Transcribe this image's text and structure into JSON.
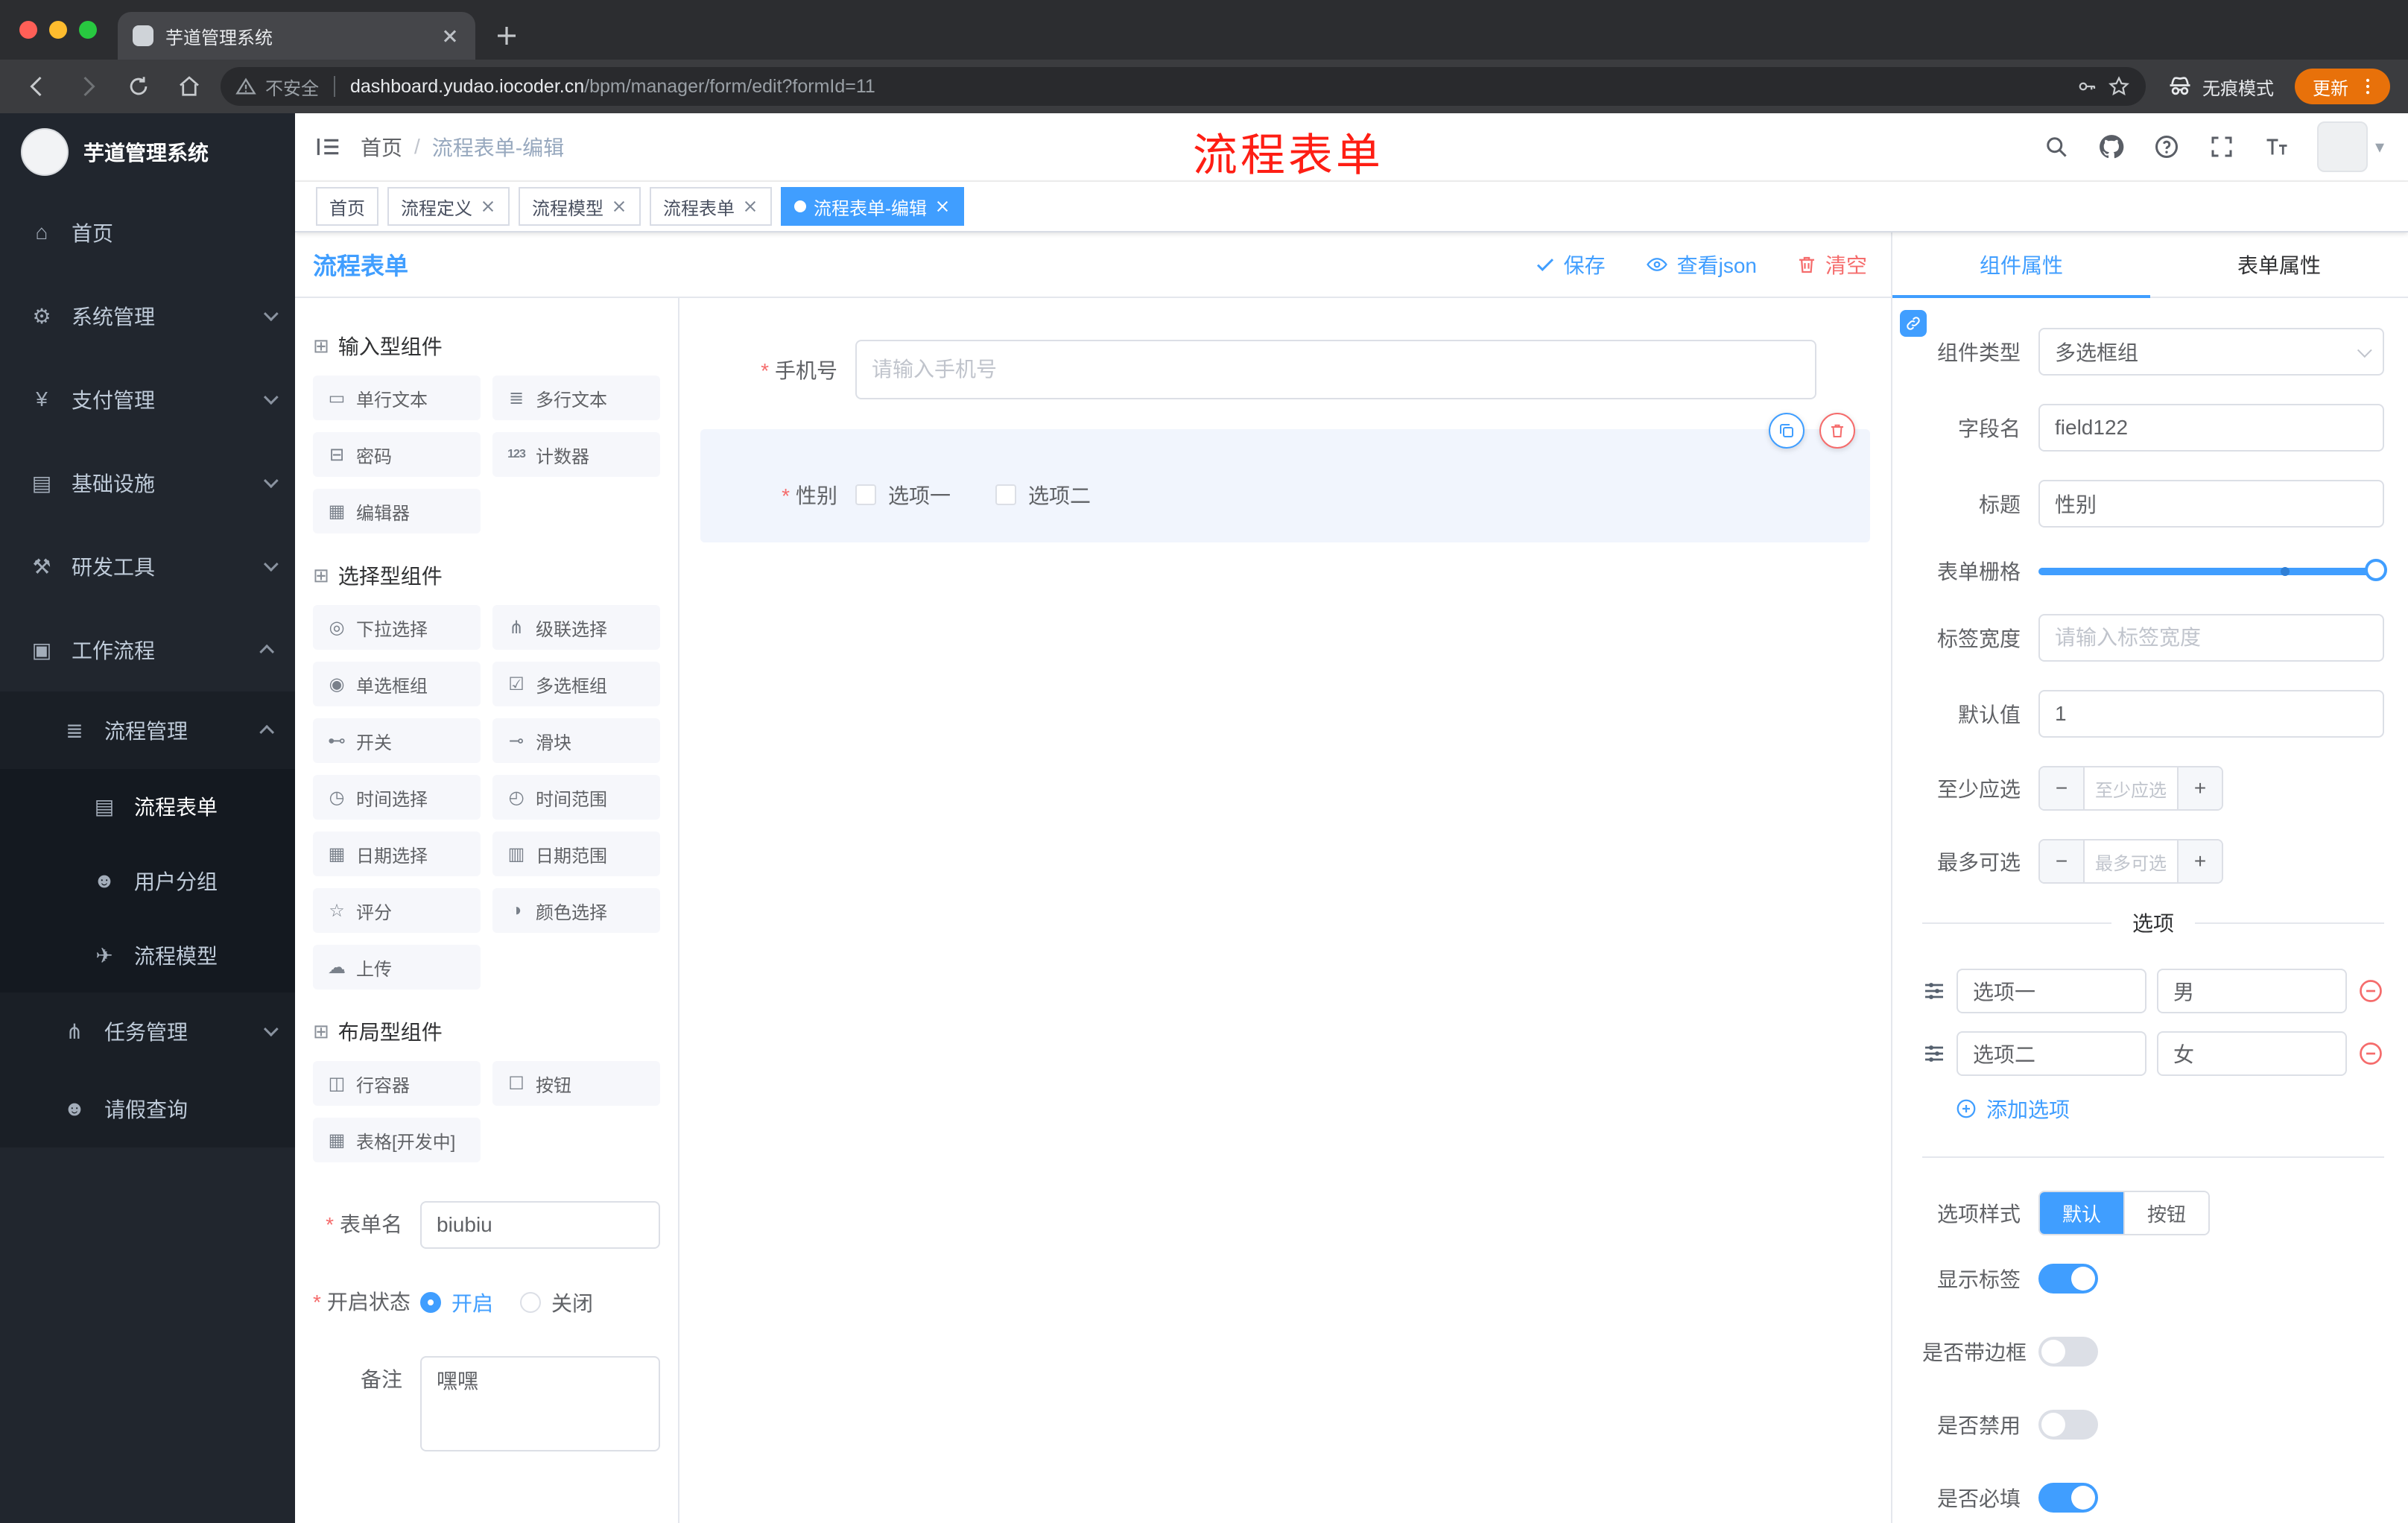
{
  "theme": {
    "primary": "#409eff",
    "danger": "#f56c6c",
    "update_badge": "#e8710a",
    "sidebar_bg": "#21262e"
  },
  "icons": {
    "minus": "−",
    "plus": "+",
    "avatar_caret": "▾",
    "group_cube": "⊞"
  },
  "browser": {
    "tab_title": "芋道管理系统",
    "security_label": "不安全",
    "url_host": "dashboard.yudao.iocoder.cn",
    "url_path": "/bpm/manager/form/edit?formId=11",
    "incognito_label": "无痕模式",
    "update_label": "更新"
  },
  "sidebar": {
    "logo_title": "芋道管理系统",
    "items": [
      {
        "label": "首页",
        "icon": "⌂"
      },
      {
        "label": "系统管理",
        "icon": "⚙"
      },
      {
        "label": "支付管理",
        "icon": "¥"
      },
      {
        "label": "基础设施",
        "icon": "▤"
      },
      {
        "label": "研发工具",
        "icon": "⚒"
      },
      {
        "label": "工作流程",
        "icon": "▣"
      },
      {
        "label": "流程管理",
        "icon": "≣"
      },
      {
        "label": "流程表单",
        "icon": "▤"
      },
      {
        "label": "用户分组",
        "icon": "☻"
      },
      {
        "label": "流程模型",
        "icon": "✈"
      },
      {
        "label": "任务管理",
        "icon": "⋔"
      },
      {
        "label": "请假查询",
        "icon": "☻"
      }
    ]
  },
  "header": {
    "breadcrumb_home": "首页",
    "breadcrumb_sep": "/",
    "breadcrumb_current": "流程表单-编辑",
    "annotation": "流程表单"
  },
  "tags": [
    {
      "label": "首页"
    },
    {
      "label": "流程定义"
    },
    {
      "label": "流程模型"
    },
    {
      "label": "流程表单"
    },
    {
      "label": "流程表单-编辑"
    }
  ],
  "designer": {
    "title": "流程表单",
    "save": "保存",
    "view_json": "查看json",
    "clear": "清空",
    "groups": [
      {
        "title": "输入型组件",
        "items": [
          {
            "label": "单行文本",
            "icon": "▭"
          },
          {
            "label": "多行文本",
            "icon": "≣"
          },
          {
            "label": "密码",
            "icon": "⊟"
          },
          {
            "label": "计数器",
            "icon": "123"
          },
          {
            "label": "编辑器",
            "icon": "▦"
          }
        ]
      },
      {
        "title": "选择型组件",
        "items": [
          {
            "label": "下拉选择",
            "icon": "◎"
          },
          {
            "label": "级联选择",
            "icon": "⋔"
          },
          {
            "label": "单选框组",
            "icon": "◉"
          },
          {
            "label": "多选框组",
            "icon": "☑"
          },
          {
            "label": "开关",
            "icon": "⊷"
          },
          {
            "label": "滑块",
            "icon": "⊸"
          },
          {
            "label": "时间选择",
            "icon": "◷"
          },
          {
            "label": "时间范围",
            "icon": "◴"
          },
          {
            "label": "日期选择",
            "icon": "▦"
          },
          {
            "label": "日期范围",
            "icon": "▥"
          },
          {
            "label": "评分",
            "icon": "☆"
          },
          {
            "label": "颜色选择",
            "icon": "◑"
          },
          {
            "label": "上传",
            "icon": "☁"
          }
        ]
      },
      {
        "title": "布局型组件",
        "items": [
          {
            "label": "行容器",
            "icon": "◫"
          },
          {
            "label": "按钮",
            "icon": "☐"
          },
          {
            "label": "表格[开发中]",
            "icon": "▦"
          }
        ]
      }
    ],
    "meta": {
      "name_label": "表单名",
      "name_value": "biubiu",
      "status_label": "开启状态",
      "status_on": "开启",
      "status_off": "关闭",
      "remark_label": "备注",
      "remark_value": "嘿嘿"
    },
    "canvas": {
      "phone_label": "手机号",
      "phone_placeholder": "请输入手机号",
      "gender_label": "性别",
      "gender_options": [
        {
          "label": "选项一"
        },
        {
          "label": "选项二"
        }
      ]
    }
  },
  "panel": {
    "tab_component": "组件属性",
    "tab_form": "表单属性",
    "component_type_label": "组件类型",
    "component_type_value": "多选框组",
    "field_name_label": "字段名",
    "field_name_value": "field122",
    "title_label": "标题",
    "title_value": "性别",
    "grid_label": "表单栅格",
    "label_width_label": "标签宽度",
    "label_width_placeholder": "请输入标签宽度",
    "default_label": "默认值",
    "default_value": "1",
    "min_label": "至少应选",
    "min_placeholder": "至少应选",
    "max_label": "最多可选",
    "max_placeholder": "最多可选",
    "options_title": "选项",
    "options": [
      {
        "label": "选项一",
        "value": "男"
      },
      {
        "label": "选项二",
        "value": "女"
      }
    ],
    "add_option": "添加选项",
    "style_label": "选项样式",
    "style_default": "默认",
    "style_button": "按钮",
    "toggle_show_label": "显示标签",
    "toggle_border": "是否带边框",
    "toggle_disabled": "是否禁用",
    "toggle_required": "是否必填"
  }
}
